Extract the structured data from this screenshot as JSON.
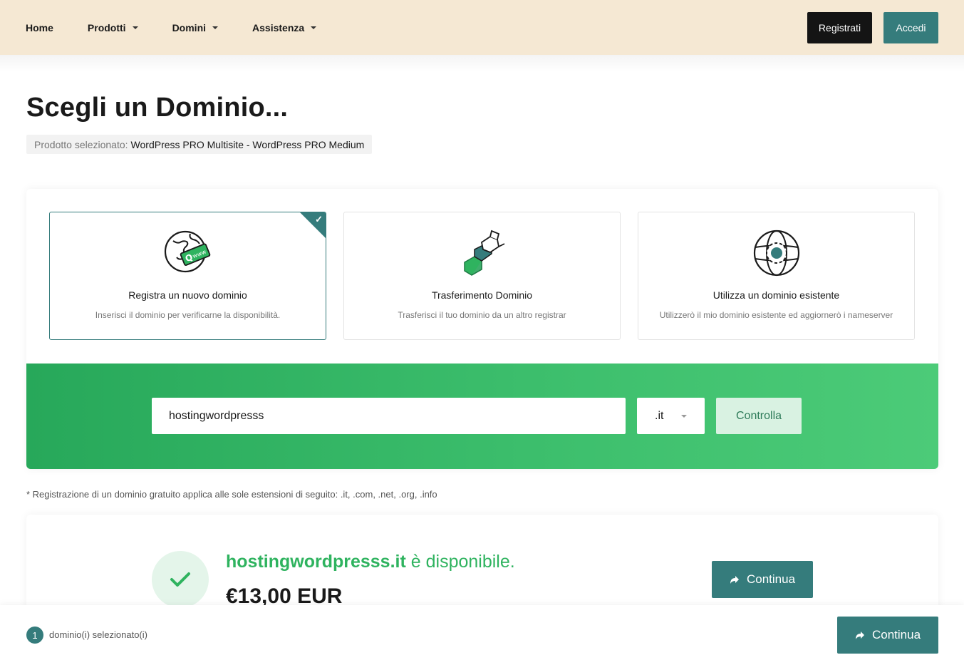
{
  "nav": {
    "items": [
      {
        "label": "Home",
        "has_dropdown": false
      },
      {
        "label": "Prodotti",
        "has_dropdown": true
      },
      {
        "label": "Domini",
        "has_dropdown": true
      },
      {
        "label": "Assistenza",
        "has_dropdown": true
      }
    ],
    "register_label": "Registrati",
    "login_label": "Accedi"
  },
  "page": {
    "title": "Scegli un Dominio...",
    "product_label": "Prodotto selezionato:",
    "product_value": "WordPress PRO Multisite - WordPress PRO Medium"
  },
  "options": [
    {
      "title": "Registra un nuovo dominio",
      "description": "Inserisci il dominio per verificarne la disponibilità.",
      "selected": true,
      "icon": "globe-www-icon"
    },
    {
      "title": "Trasferimento Dominio",
      "description": "Trasferisci il tuo dominio da un altro registrar",
      "selected": false,
      "icon": "transfer-icon"
    },
    {
      "title": "Utilizza un dominio esistente",
      "description": "Utilizzerò il mio dominio esistente ed aggiornerò i nameserver",
      "selected": false,
      "icon": "existing-domain-icon"
    }
  ],
  "search": {
    "domain_value": "hostingwordpresss",
    "tld_value": ".it",
    "check_label": "Controlla"
  },
  "note": "* Registrazione di un dominio gratuito applica alle sole estensioni di seguito: .it, .com, .net, .org, .info",
  "result": {
    "domain": "hostingwordpresss.it",
    "status_text": "è disponibile.",
    "price": "€13,00 EUR",
    "continue_label": "Continua"
  },
  "footer": {
    "selected_count": "1",
    "selected_label": "dominio(i) selezionato(i)",
    "continue_label": "Continua"
  },
  "colors": {
    "header_bg": "#f5e8d3",
    "accent_teal": "#357c7c",
    "success_green": "#2fb35f"
  }
}
